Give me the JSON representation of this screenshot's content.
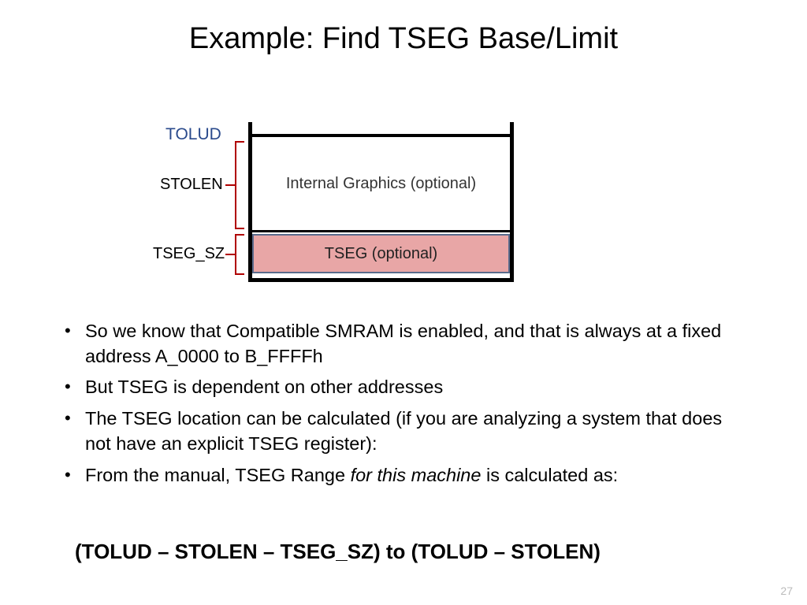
{
  "title": "Example: Find TSEG Base/Limit",
  "diagram": {
    "tolud": "TOLUD",
    "stolen": "STOLEN",
    "tseg_sz": "TSEG_SZ",
    "row_ig": "Internal Graphics (optional)",
    "row_tseg": "TSEG (optional)"
  },
  "bullets": {
    "b1": "So we know that Compatible SMRAM is enabled, and that is always at a fixed address A_0000 to B_FFFFh",
    "b2": "But TSEG is dependent on other addresses",
    "b3": "The TSEG location can be calculated (if you are analyzing a system that does not have an explicit TSEG register):",
    "b4_a": "From the manual, TSEG Range ",
    "b4_i": "for this machine",
    "b4_b": " is calculated as:"
  },
  "formula": "(TOLUD – STOLEN – TSEG_SZ) to  (TOLUD – STOLEN)",
  "page": "27"
}
